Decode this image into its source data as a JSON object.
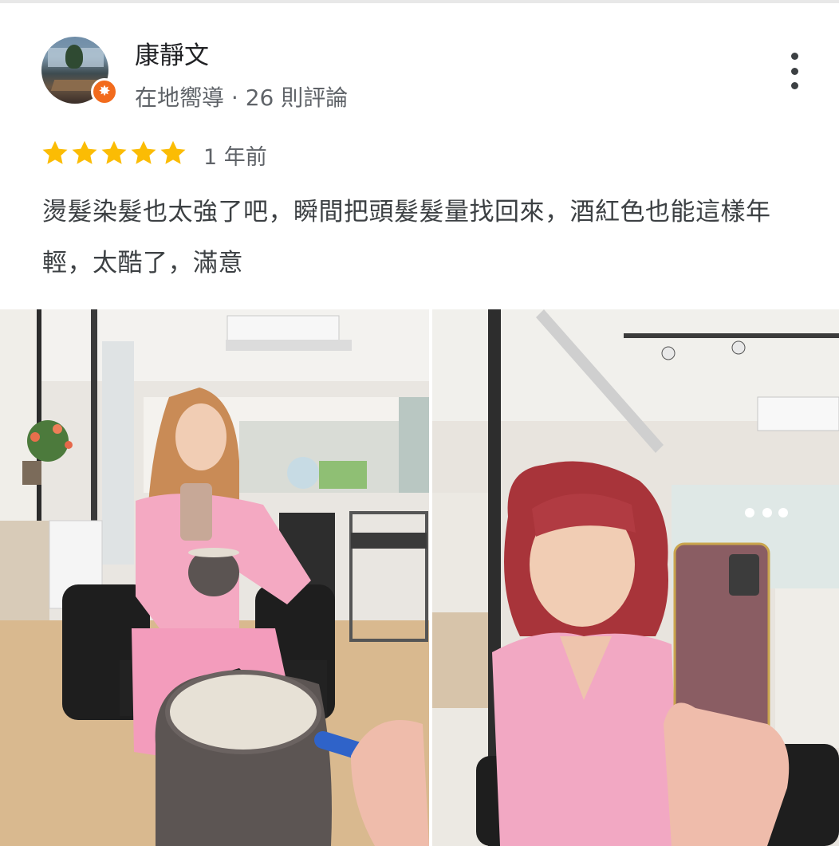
{
  "reviewer": {
    "name": "康靜文",
    "meta": "在地嚮導 · 26 則評論",
    "badge_icon": "local-guide-star-icon",
    "avatar_icon": "avatar-photo"
  },
  "menu": {
    "icon": "more-vertical-icon"
  },
  "rating": {
    "stars": 5,
    "max": 5,
    "color": "#fbbc04",
    "time": "1 年前"
  },
  "review_text": "燙髮染髮也太強了吧，瞬間把頭髮髮量找回來，酒紅色也能這樣年輕，太酷了，滿意",
  "photos": [
    {
      "name": "review-photo-1",
      "description_icon": "salon-mirror-selfie-photo"
    },
    {
      "name": "review-photo-2",
      "description_icon": "red-hair-selfie-photo"
    }
  ],
  "colors": {
    "badge": "#f26b1d",
    "name": "#202124",
    "secondary": "#5f6368"
  }
}
